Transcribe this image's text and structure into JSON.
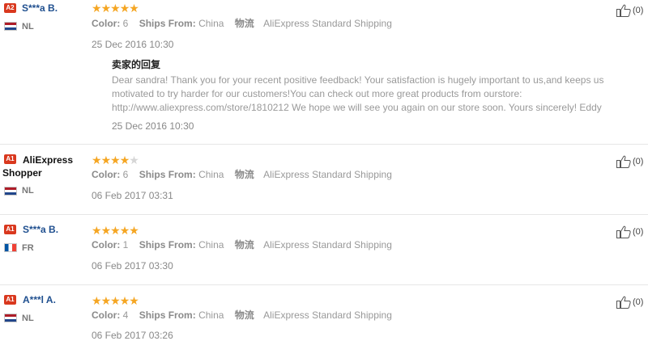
{
  "reviews": [
    {
      "badge": "A2",
      "name": "S***a B.",
      "country": "NL",
      "stars": 5,
      "color_label": "Color:",
      "color_value": "6",
      "ships_label": "Ships From:",
      "ships_value": "China",
      "logistics_label": "物流",
      "logistics_value": "AliExpress Standard Shipping",
      "date": "25 Dec 2016 10:30",
      "helpful": "(0)",
      "reply": {
        "title": "卖家的回复",
        "text": "Dear sandra! Thank you for your recent positive feedback! Your satisfaction is hugely important to us,and keeps us motivated to try harder for our customers!You can check out more great products from ourstore: http://www.aliexpress.com/store/1810212 We hope we will see you again on our store soon. Yours sincerely! Eddy",
        "date": "25 Dec 2016 10:30"
      }
    },
    {
      "badge": "A1",
      "name": "AliExpress Shopper",
      "country": "NL",
      "stars": 4,
      "color_label": "Color:",
      "color_value": "6",
      "ships_label": "Ships From:",
      "ships_value": "China",
      "logistics_label": "物流",
      "logistics_value": "AliExpress Standard Shipping",
      "date": "06 Feb 2017 03:31",
      "helpful": "(0)"
    },
    {
      "badge": "A1",
      "name": "S***a B.",
      "country": "FR",
      "stars": 5,
      "color_label": "Color:",
      "color_value": "1",
      "ships_label": "Ships From:",
      "ships_value": "China",
      "logistics_label": "物流",
      "logistics_value": "AliExpress Standard Shipping",
      "date": "06 Feb 2017 03:30",
      "helpful": "(0)"
    },
    {
      "badge": "A1",
      "name": "A***l A.",
      "country": "NL",
      "stars": 5,
      "color_label": "Color:",
      "color_value": "4",
      "ships_label": "Ships From:",
      "ships_value": "China",
      "logistics_label": "物流",
      "logistics_value": "AliExpress Standard Shipping",
      "date": "06 Feb 2017 03:26",
      "helpful": "(0)"
    }
  ],
  "icons": {
    "helpful": "thumbs-up-icon",
    "star": "star-icon",
    "flag_nl": "flag-netherlands-icon",
    "flag_fr": "flag-france-icon"
  },
  "colors": {
    "badge": "#d9381e",
    "name": "#1f4f8f",
    "star": "#f5a623",
    "star_empty": "#d6d6d6"
  }
}
